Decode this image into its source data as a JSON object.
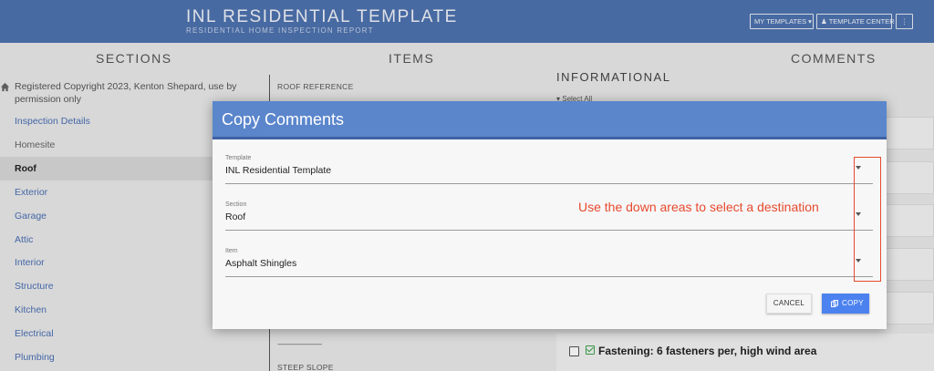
{
  "header": {
    "title": "INL RESIDENTIAL TEMPLATE",
    "subtitle": "RESIDENTIAL HOME INSPECTION REPORT",
    "my_templates_label": "MY TEMPLATES ▾",
    "template_center_label": "TEMPLATE CENTER",
    "more_label": "⋮"
  },
  "columns": {
    "sections": "SECTIONS",
    "items": "ITEMS",
    "comments": "COMMENTS"
  },
  "sections": {
    "copyright": "Registered Copyright 2023, Kenton Shepard, use by permission only",
    "items": [
      {
        "label": "Inspection Details"
      },
      {
        "label": "Homesite"
      },
      {
        "label": "Roof"
      },
      {
        "label": "Exterior"
      },
      {
        "label": "Garage"
      },
      {
        "label": "Attic"
      },
      {
        "label": "Interior"
      },
      {
        "label": "Structure"
      },
      {
        "label": "Kitchen"
      },
      {
        "label": "Electrical"
      },
      {
        "label": "Plumbing"
      }
    ]
  },
  "items_col": {
    "roof_reference": "ROOF REFERENCE",
    "divider_text": "-----------------------------",
    "steep_slope": "STEEP SLOPE"
  },
  "comments_col": {
    "informational": "INFORMATIONAL",
    "select_all": "▾ Select All",
    "fastening_text": "Fastening: 6 fasteners per, high wind area"
  },
  "modal": {
    "title": "Copy Comments",
    "template_label": "Template",
    "template_value": "INL Residential Template",
    "section_label": "Section",
    "section_value": "Roof",
    "item_label": "Item",
    "item_value": "Asphalt Shingles",
    "annotation": "Use the down areas to select a destination",
    "cancel_label": "CANCEL",
    "copy_label": "COPY"
  },
  "colors": {
    "header": "#4f74b0",
    "modal_header": "#5b86cc",
    "primary_button": "#4c82f0",
    "annotation": "#e64a2e"
  }
}
